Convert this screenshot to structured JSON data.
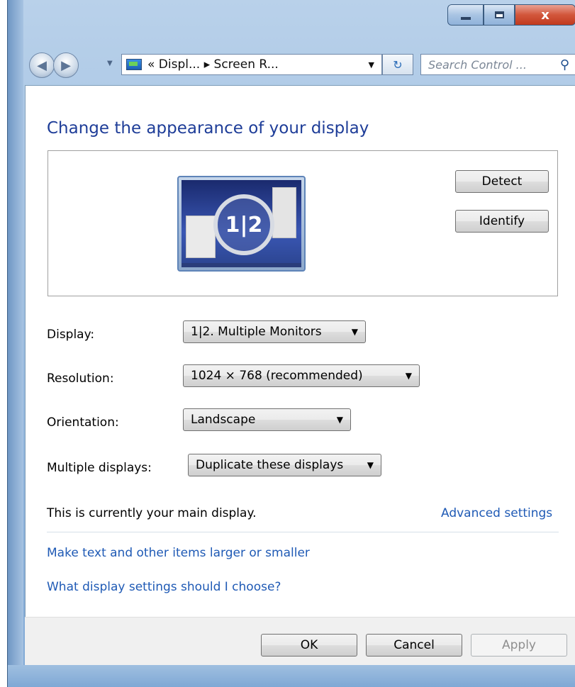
{
  "titlebar": {
    "minimize_icon": "minimize-icon",
    "maximize_icon": "maximize-icon",
    "close_label": "x"
  },
  "navbar": {
    "back_icon": "back-arrow-icon",
    "forward_icon": "forward-arrow-icon",
    "address_text": "« Displ... ▸ Screen R...",
    "address_icon": "display-icon",
    "refresh_icon": "refresh-icon",
    "search_placeholder": "Search Control ...",
    "search_icon": "search-icon"
  },
  "main": {
    "heading": "Change the appearance of your display",
    "monitor_number": "1|2",
    "detect_label": "Detect",
    "identify_label": "Identify"
  },
  "form": {
    "display_label": "Display:",
    "display_value": "1|2. Multiple Monitors",
    "resolution_label": "Resolution:",
    "resolution_value": "1024 × 768 (recommended)",
    "orientation_label": "Orientation:",
    "orientation_value": "Landscape",
    "multiple_label": "Multiple displays:",
    "multiple_value": "Duplicate these displays"
  },
  "info": {
    "main_display_text": "This is currently your main display.",
    "advanced_link": "Advanced settings",
    "larger_text_link": "Make text and other items larger or smaller",
    "settings_help_link": "What display settings should I choose?"
  },
  "footer": {
    "ok_label": "OK",
    "cancel_label": "Cancel",
    "apply_label": "Apply"
  }
}
